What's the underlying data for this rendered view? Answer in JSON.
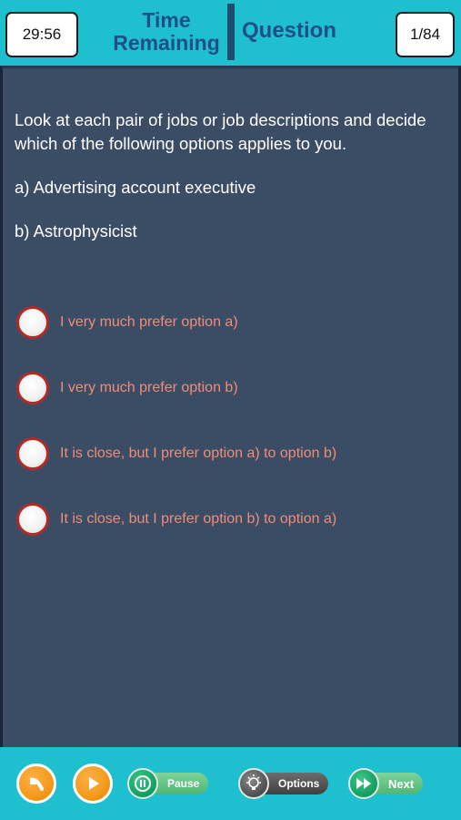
{
  "header": {
    "timer_value": "29:56",
    "time_title_line1": "Time",
    "time_title_line2": "Remaining",
    "question_title": "Question",
    "question_counter": "1/84"
  },
  "question": {
    "prompt": "Look at each pair of jobs or job descriptions and decide which of the following options applies to you.",
    "option_a": "a) Advertising account executive",
    "option_b": "b) Astrophysicist"
  },
  "answers": [
    {
      "label": "I very much prefer option a)"
    },
    {
      "label": "I very much prefer option b)"
    },
    {
      "label": "It is close, but I prefer option a) to option b)"
    },
    {
      "label": "It is close, but I prefer option b) to option a)"
    }
  ],
  "toolbar": {
    "back_icon": "back-arrow-icon",
    "play_icon": "play-icon",
    "pause_label": "Pause",
    "options_label": "Options",
    "next_label": "Next"
  },
  "colors": {
    "accent": "#1ec0cf",
    "panel": "#3b4c65",
    "title": "#1f4f86",
    "answer_text": "#f08c78",
    "radio_border": "#b22a26",
    "orange": "#f39a1a",
    "green": "#4fb672"
  }
}
